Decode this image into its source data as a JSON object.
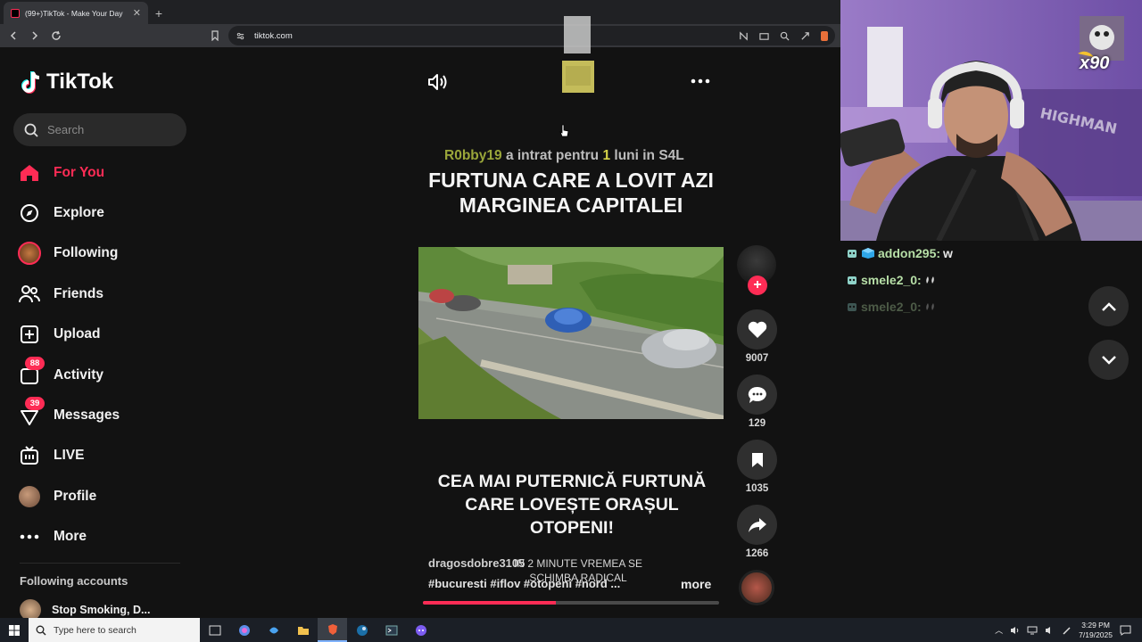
{
  "browser": {
    "tab_title": "(99+)TikTok - Make Your Day",
    "url": "tiktok.com"
  },
  "sidebar": {
    "logo": "TikTok",
    "search_placeholder": "Search",
    "items": [
      {
        "label": "For You",
        "icon": "home-icon",
        "active": true
      },
      {
        "label": "Explore",
        "icon": "compass-icon"
      },
      {
        "label": "Following",
        "icon": "following-avatar"
      },
      {
        "label": "Friends",
        "icon": "friends-icon"
      },
      {
        "label": "Upload",
        "icon": "upload-icon"
      },
      {
        "label": "Activity",
        "icon": "activity-icon",
        "badge": "88"
      },
      {
        "label": "Messages",
        "icon": "messages-icon",
        "badge": "39"
      },
      {
        "label": "LIVE",
        "icon": "live-icon"
      },
      {
        "label": "Profile",
        "icon": "profile-avatar"
      },
      {
        "label": "More",
        "icon": "more-dots-icon"
      }
    ],
    "following_accounts_title": "Following accounts",
    "following_accounts": [
      {
        "name": "Stop Smoking, D..."
      }
    ]
  },
  "feed": {
    "sub_notification": {
      "user": "R0bby19",
      "middle": "a intrat pentru",
      "count": "1",
      "tail": "luni in S4L"
    },
    "headline": "FURTUNA CARE A LOVIT AZI MARGINEA CAPITALEI",
    "caption": "CEA MAI PUTERNICĂ FURTUNĂ CARE LOVEȘTE ORAȘUL OTOPENI!",
    "overlay_text": "IN 2 MINUTE VREMEA SE SCHIMBA RADICAL",
    "author": "dragosdobre3105",
    "hashtags": "#bucuresti  #iflov  #otopeni  #nord  ...",
    "more_label": "more",
    "progress_fraction": 0.45,
    "likes": "9007",
    "comments": "129",
    "saves": "1035",
    "shares": "1266",
    "accent_color": "#fe2c55"
  },
  "stream": {
    "gift_label": "x90",
    "chat": [
      {
        "user": "addon295:",
        "message": "w",
        "faded": false
      },
      {
        "user": "smele2_0:",
        "message": "",
        "faded": false
      },
      {
        "user": "smele2_0:",
        "message": "",
        "faded": true
      }
    ]
  },
  "taskbar": {
    "search_placeholder": "Type here to search",
    "time": "3:29 PM",
    "date": "7/19/2025"
  }
}
